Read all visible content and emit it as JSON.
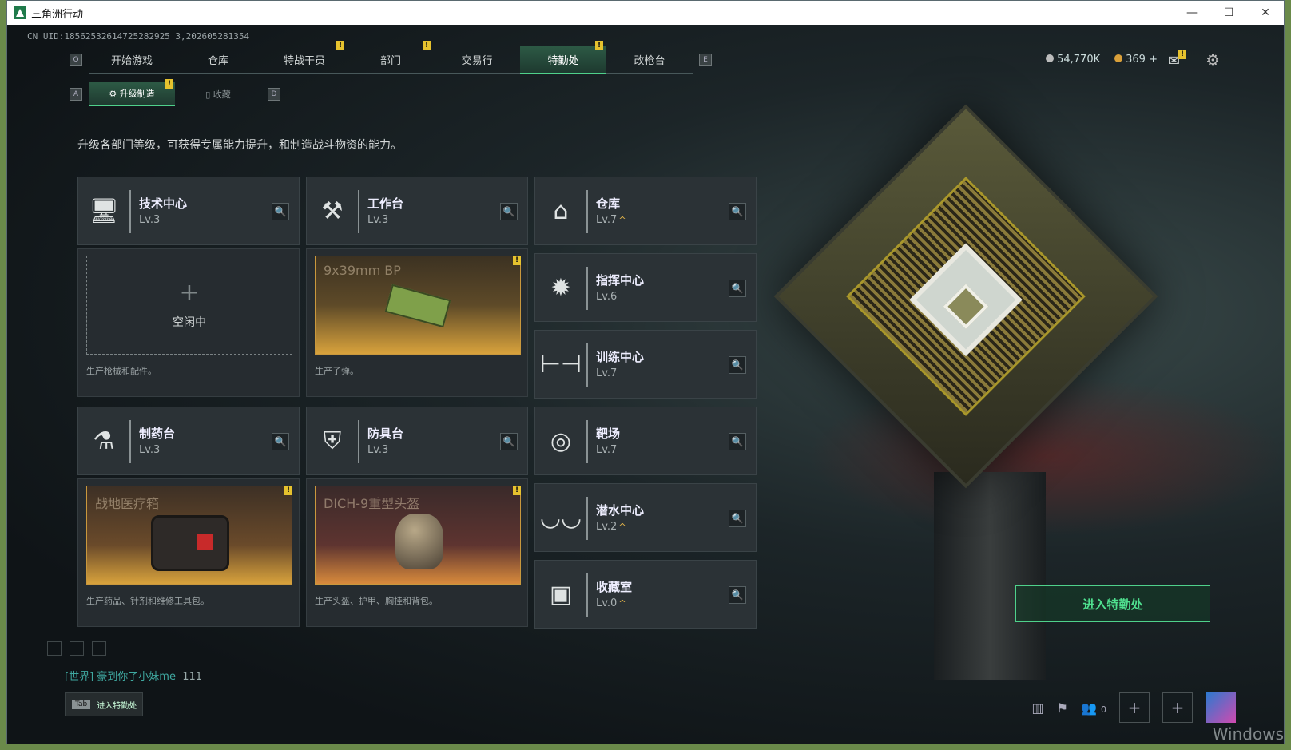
{
  "window": {
    "title": "三角洲行动",
    "min": "—",
    "max": "☐",
    "close": "✕"
  },
  "uid": "CN UID:18562532614725282925 3,202605281354",
  "tabs": [
    {
      "key": "Q"
    },
    {
      "label": "开始游戏"
    },
    {
      "label": "仓库"
    },
    {
      "label": "特战干员",
      "badge": "!"
    },
    {
      "label": "部门",
      "badge": "!"
    },
    {
      "label": "交易行"
    },
    {
      "label": "特勤处",
      "badge": "!",
      "active": true
    },
    {
      "label": "改枪台"
    },
    {
      "key": "E"
    }
  ],
  "tab_keys": {
    "left": "Q",
    "right": "E"
  },
  "resources": {
    "silver": "54,770K",
    "gold": "369",
    "gold_plus": "+"
  },
  "mail_badge": "!",
  "subtabs": {
    "left_key": "A",
    "right_key": "D",
    "upgrade": "升级制造",
    "upgrade_badge": "!",
    "collect": "收藏"
  },
  "description": "升级各部门等级，可获得专属能力提升，和制造战斗物资的能力。",
  "facilities": {
    "tech": {
      "name": "技术中心",
      "level": "Lv.3"
    },
    "workbench": {
      "name": "工作台",
      "level": "Lv.3"
    },
    "warehouse": {
      "name": "仓库",
      "level": "Lv.7",
      "up": "^"
    },
    "command": {
      "name": "指挥中心",
      "level": "Lv.6"
    },
    "training": {
      "name": "训练中心",
      "level": "Lv.7"
    },
    "pharmacy": {
      "name": "制药台",
      "level": "Lv.3"
    },
    "armor": {
      "name": "防具台",
      "level": "Lv.3"
    },
    "range": {
      "name": "靶场",
      "level": "Lv.7"
    },
    "dive": {
      "name": "潜水中心",
      "level": "Lv.2",
      "up": "^"
    },
    "collection": {
      "name": "收藏室",
      "level": "Lv.0",
      "up": "^"
    }
  },
  "production": {
    "tech": {
      "status": "空闲中",
      "plus": "+",
      "desc": "生产枪械和配件。"
    },
    "workbench": {
      "item": "9x39mm BP",
      "badge": "!",
      "desc": "生产子弹。"
    },
    "pharmacy": {
      "item": "战地医疗箱",
      "badge": "!",
      "desc": "生产药品、针剂和维修工具包。"
    },
    "armor": {
      "item": "DICH-9重型头盔",
      "badge": "!",
      "desc": "生产头盔、护甲、胸挂和背包。"
    }
  },
  "enter_button": "进入特勤处",
  "chat": {
    "channel": "[世界]",
    "sender": "豪到你了小妹me",
    "message": "111"
  },
  "tab_hint": {
    "key": "Tab",
    "label": "进入特勤处"
  },
  "bottom": {
    "friends_count": "0",
    "plus": "+"
  },
  "watermark": "Windows"
}
